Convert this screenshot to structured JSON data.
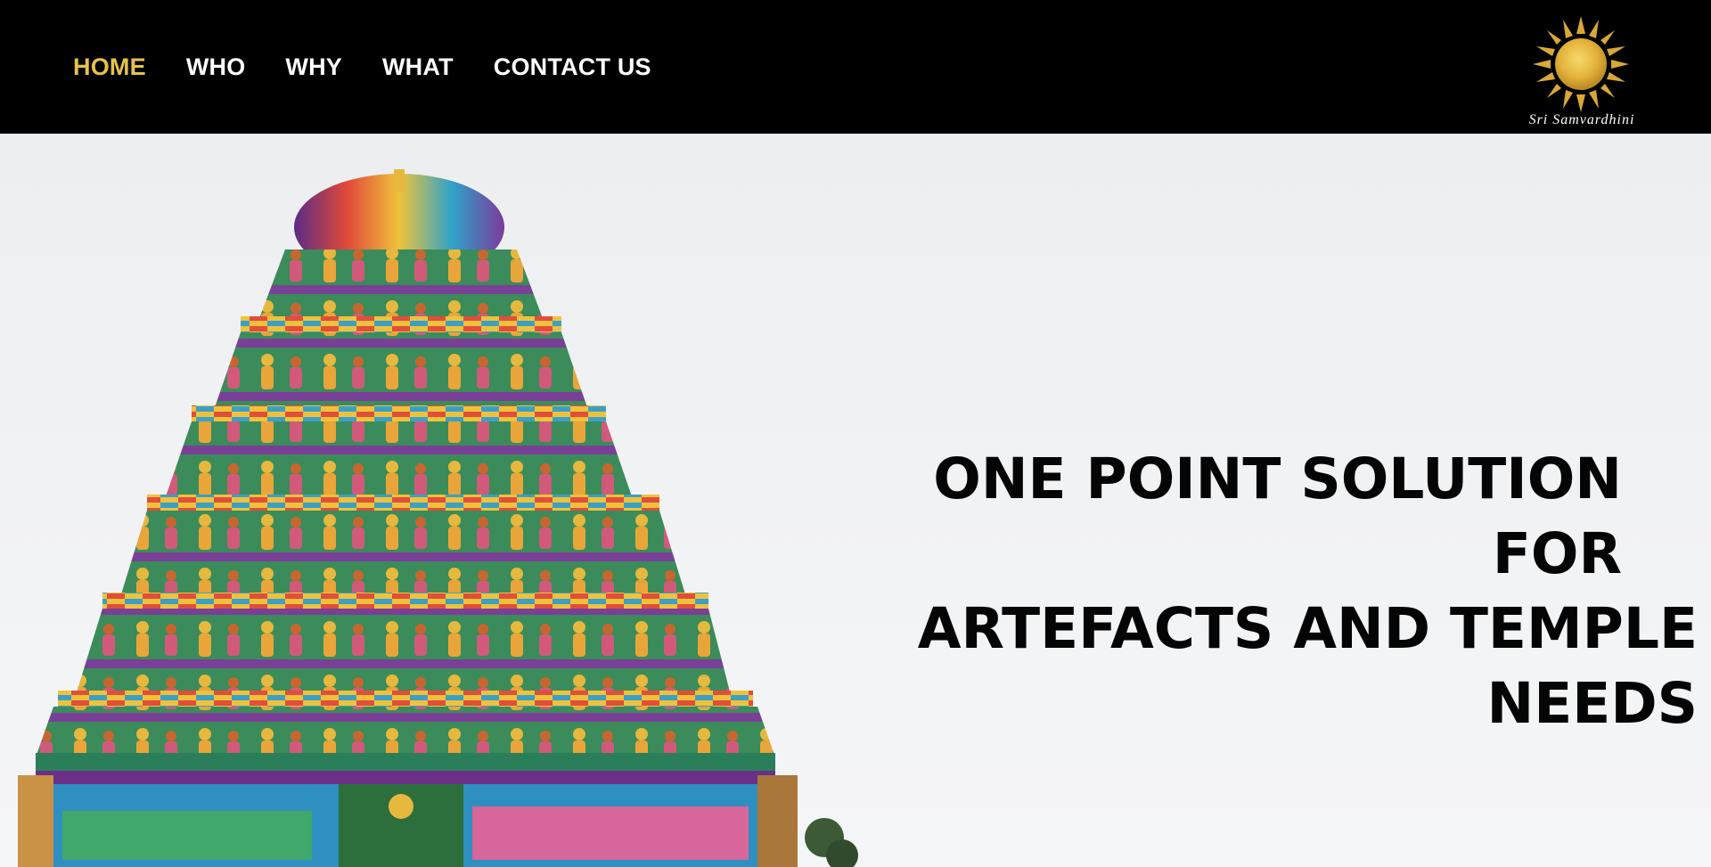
{
  "nav": {
    "items": [
      {
        "label": "HOME",
        "active": true
      },
      {
        "label": "WHO",
        "active": false
      },
      {
        "label": "WHY",
        "active": false
      },
      {
        "label": "WHAT",
        "active": false
      },
      {
        "label": "CONTACT US",
        "active": false
      }
    ]
  },
  "logo": {
    "name": "Sri Samvardhini",
    "icon": "sun-and-crescent-moon-icon"
  },
  "hero": {
    "headline_line1": "ONE POINT SOLUTION FOR",
    "headline_line2": "ARTEFACTS AND TEMPLE NEEDS",
    "image": "temple-gopuram-image"
  },
  "colors": {
    "header_bg": "#000000",
    "nav_active": "#e7c24a",
    "nav_text": "#ffffff",
    "hero_bg": "#f0f1f3",
    "headline_text": "#050505"
  }
}
